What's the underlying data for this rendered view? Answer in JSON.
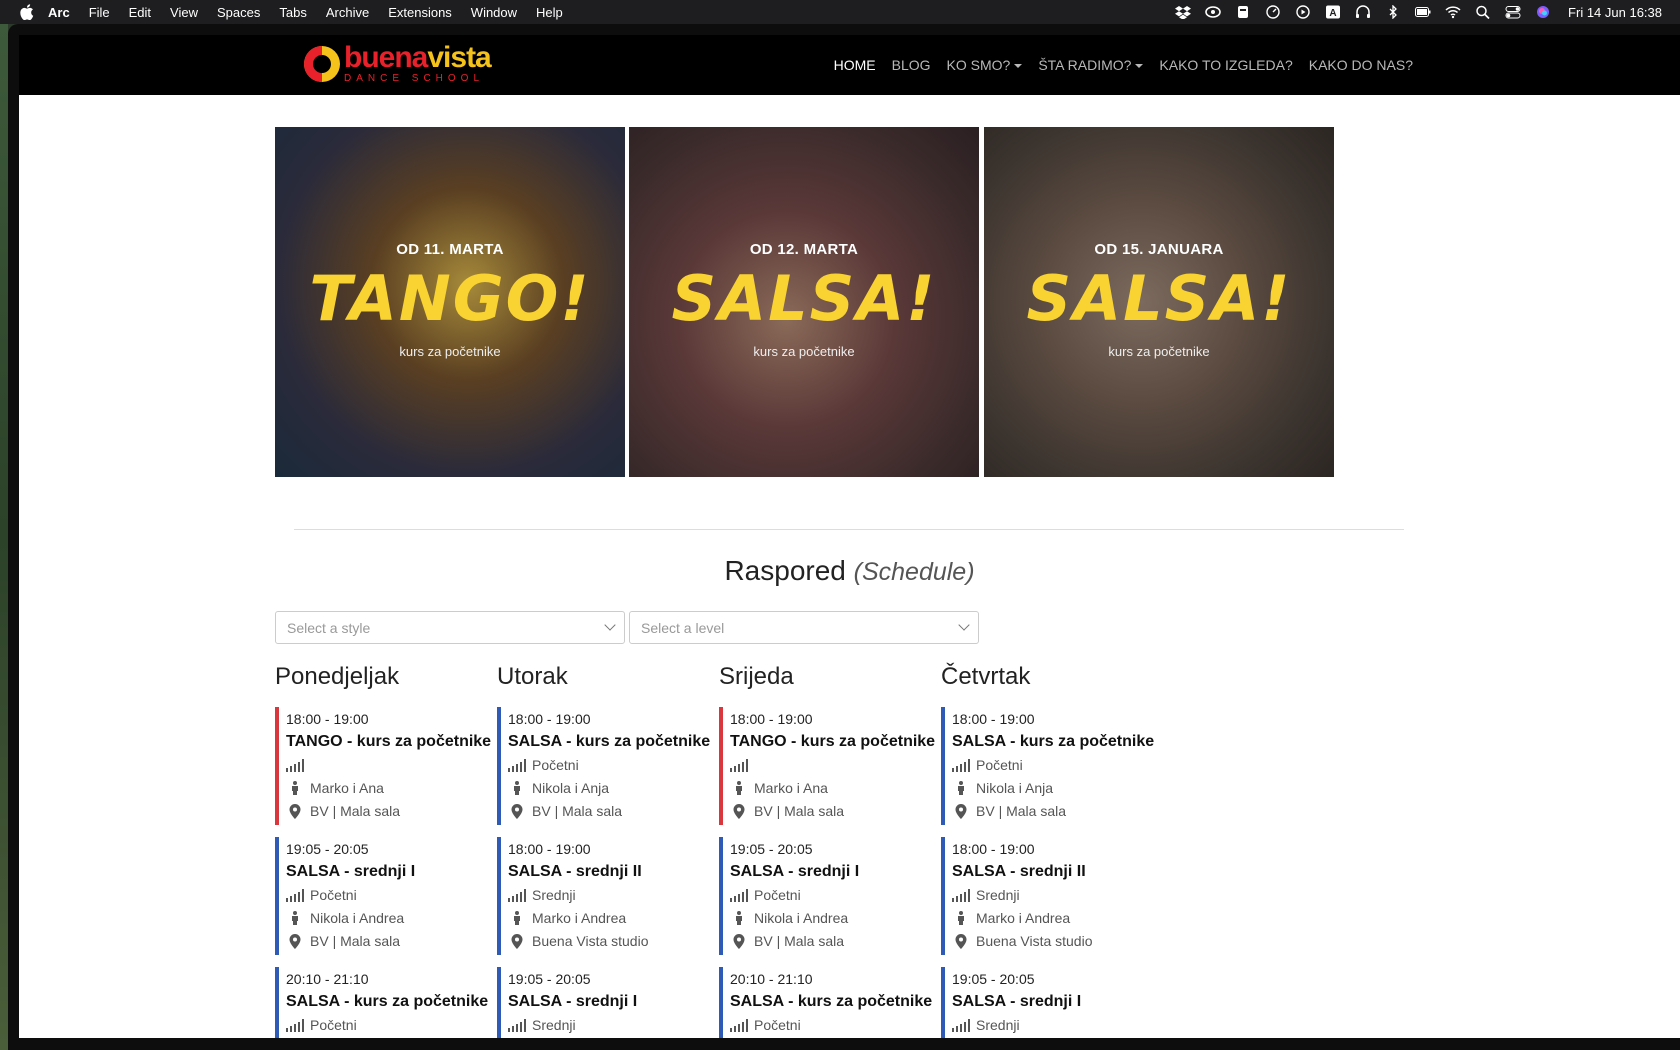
{
  "menubar": {
    "app": "Arc",
    "items": [
      "File",
      "Edit",
      "View",
      "Spaces",
      "Tabs",
      "Archive",
      "Extensions",
      "Window",
      "Help"
    ],
    "clock": "Fri 14 Jun  16:38",
    "status_icons": [
      "dropbox-icon",
      "creative-cloud-icon",
      "app-icon",
      "timer-icon",
      "play-icon",
      "keyboard-a-icon",
      "headphones-icon",
      "bluetooth-icon",
      "battery-icon",
      "wifi-icon",
      "search-icon",
      "control-center-icon",
      "siri-icon"
    ]
  },
  "site": {
    "logo_name_a": "buena",
    "logo_name_b": "vista",
    "logo_sub": "DANCE SCHOOL",
    "nav": [
      {
        "label": "HOME",
        "active": true,
        "dropdown": false
      },
      {
        "label": "BLOG",
        "active": false,
        "dropdown": false
      },
      {
        "label": "KO SMO?",
        "active": false,
        "dropdown": true
      },
      {
        "label": "ŠTA RADIMO?",
        "active": false,
        "dropdown": true
      },
      {
        "label": "KAKO TO IZGLEDA?",
        "active": false,
        "dropdown": false
      },
      {
        "label": "KAKO DO NAS?",
        "active": false,
        "dropdown": false
      }
    ]
  },
  "banners": [
    {
      "date": "OD 11. MARTA",
      "title": "TANGO!",
      "sub": "kurs za početnike"
    },
    {
      "date": "OD 12. MARTA",
      "title": "SALSA!",
      "sub": "kurs za početnike"
    },
    {
      "date": "OD 15. JANUARA",
      "title": "SALSA!",
      "sub": "kurs za početnike"
    }
  ],
  "schedule": {
    "title": "Raspored",
    "title_em": "(Schedule)",
    "style_placeholder": "Select a style",
    "level_placeholder": "Select a level",
    "days": [
      {
        "name": "Ponedjeljak",
        "slots": [
          {
            "time": "18:00 - 19:00",
            "name": "TANGO - kurs za početnike",
            "level": "",
            "teachers": "Marko i Ana",
            "place": "BV | Mala sala",
            "color": "#d9363e"
          },
          {
            "time": "19:05 - 20:05",
            "name": "SALSA - srednji I",
            "level": "Početni",
            "teachers": "Nikola i Andrea",
            "place": "BV | Mala sala",
            "color": "#2f5bb7"
          },
          {
            "time": "20:10 - 21:10",
            "name": "SALSA - kurs za početnike",
            "level": "Početni",
            "teachers": "",
            "place": "",
            "color": "#2f5bb7"
          }
        ]
      },
      {
        "name": "Utorak",
        "slots": [
          {
            "time": "18:00 - 19:00",
            "name": "SALSA - kurs za početnike",
            "level": "Početni",
            "teachers": "Nikola i Anja",
            "place": "BV | Mala sala",
            "color": "#2f5bb7"
          },
          {
            "time": "18:00 - 19:00",
            "name": "SALSA - srednji II",
            "level": "Srednji",
            "teachers": "Marko i Andrea",
            "place": "Buena Vista studio",
            "color": "#2f5bb7"
          },
          {
            "time": "19:05 - 20:05",
            "name": "SALSA - srednji I",
            "level": "Srednji",
            "teachers": "",
            "place": "",
            "color": "#2f5bb7"
          }
        ]
      },
      {
        "name": "Srijeda",
        "slots": [
          {
            "time": "18:00 - 19:00",
            "name": "TANGO - kurs za početnike",
            "level": "",
            "teachers": "Marko i Ana",
            "place": "BV | Mala sala",
            "color": "#d9363e"
          },
          {
            "time": "19:05 - 20:05",
            "name": "SALSA - srednji I",
            "level": "Početni",
            "teachers": "Nikola i Andrea",
            "place": "BV | Mala sala",
            "color": "#2f5bb7"
          },
          {
            "time": "20:10 - 21:10",
            "name": "SALSA - kurs za početnike",
            "level": "Početni",
            "teachers": "",
            "place": "",
            "color": "#2f5bb7"
          }
        ]
      },
      {
        "name": "Četvrtak",
        "slots": [
          {
            "time": "18:00 - 19:00",
            "name": "SALSA - kurs za početnike",
            "level": "Početni",
            "teachers": "Nikola i Anja",
            "place": "BV | Mala sala",
            "color": "#2f5bb7"
          },
          {
            "time": "18:00 - 19:00",
            "name": "SALSA - srednji II",
            "level": "Srednji",
            "teachers": "Marko i Andrea",
            "place": "Buena Vista studio",
            "color": "#2f5bb7"
          },
          {
            "time": "19:05 - 20:05",
            "name": "SALSA - srednji I",
            "level": "Srednji",
            "teachers": "",
            "place": "",
            "color": "#2f5bb7"
          }
        ]
      }
    ]
  }
}
